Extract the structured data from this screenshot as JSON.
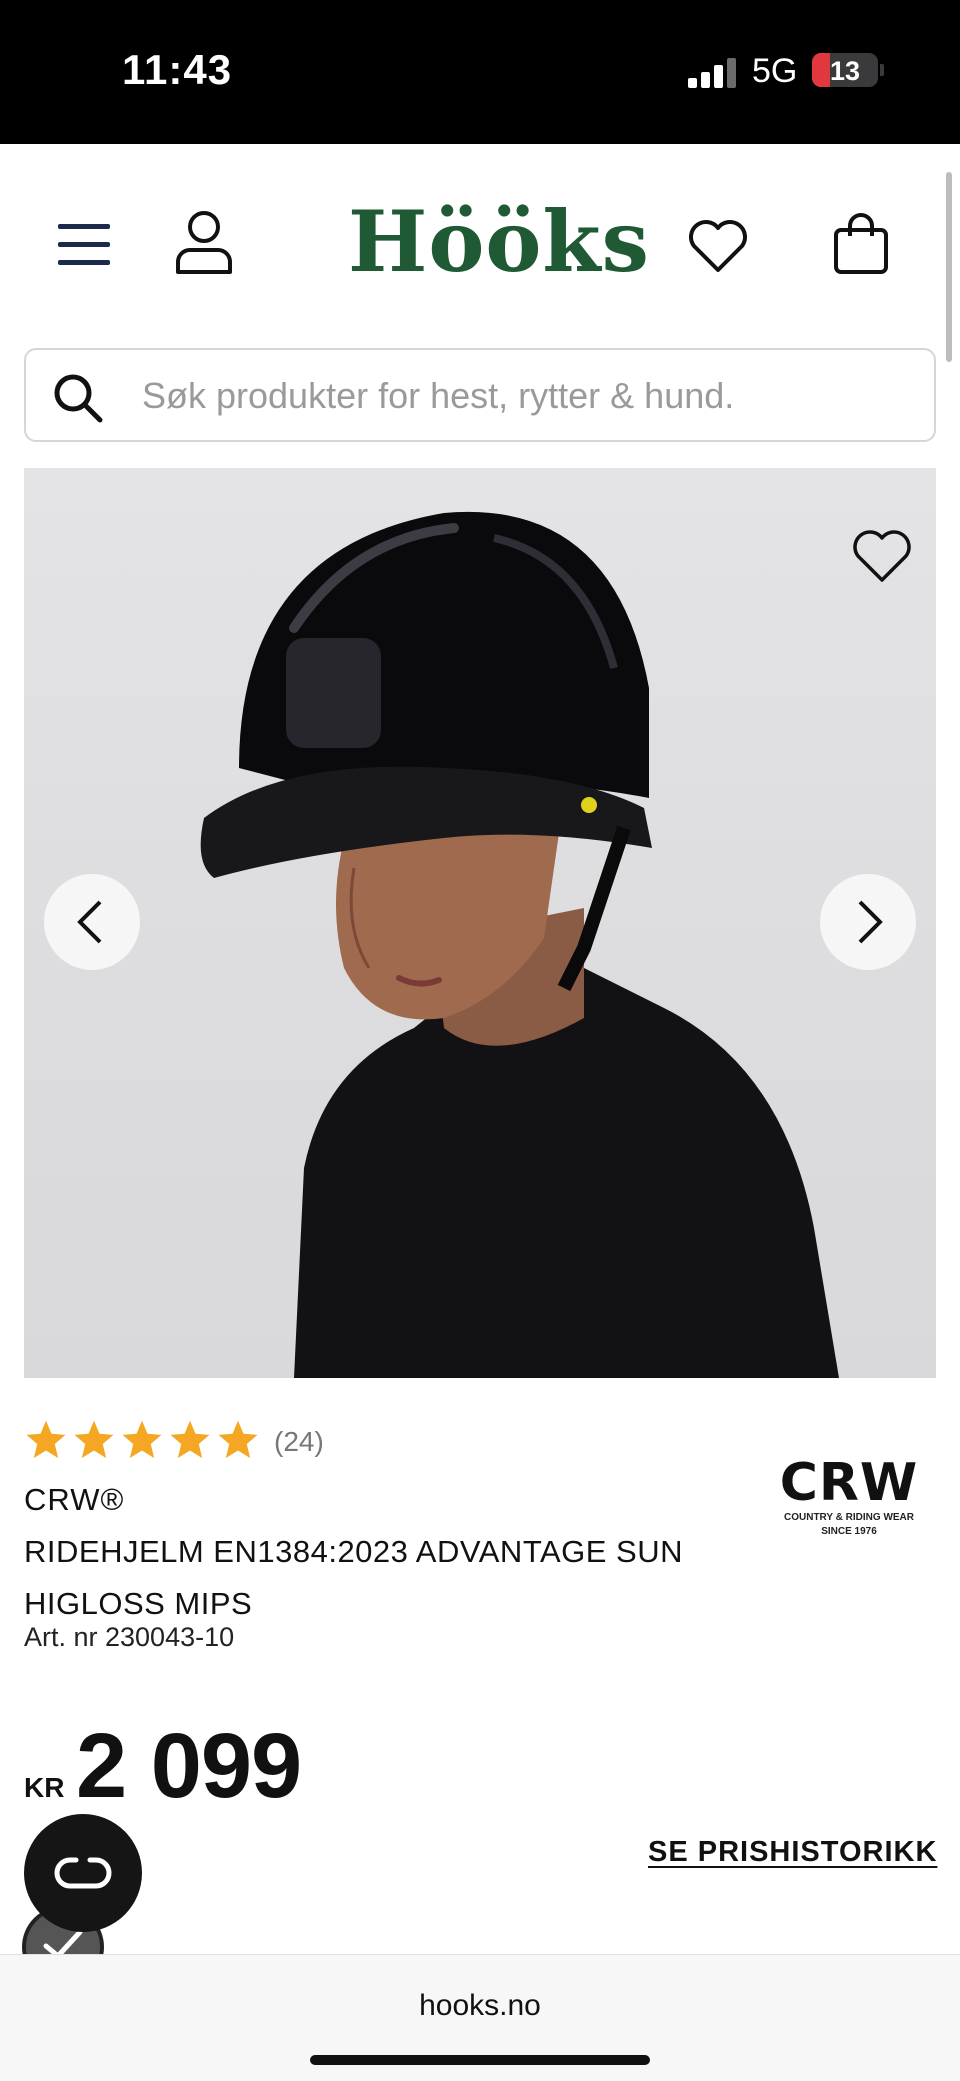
{
  "status_bar": {
    "time": "11:43",
    "network": "5G",
    "battery": "13"
  },
  "header": {
    "logo": "Hööks",
    "menu_icon": "hamburger-icon",
    "account_icon": "user-icon",
    "wishlist_icon": "heart-icon",
    "cart_icon": "shopping-bag-icon",
    "logo_color": "#1f5a34"
  },
  "search": {
    "placeholder": "Søk produkter for hest, rytter & hund."
  },
  "product": {
    "rating": {
      "stars": 5,
      "count": "(24)",
      "star_color": "#f5a623"
    },
    "brand": "CRW®",
    "title": "RIDEHJELM EN1384:2023 ADVANTAGE SUN HIGLOSS MIPS",
    "art_nr": "Art. nr 230043-10",
    "brand_logo": {
      "mark": "CRW",
      "line1": "COUNTRY & RIDING WEAR",
      "line2": "SINCE 1976"
    },
    "price": {
      "currency": "KR",
      "value": "2 099"
    },
    "price_history_label": "SE PRISHISTORIKK"
  },
  "browser": {
    "url": "hooks.no"
  }
}
